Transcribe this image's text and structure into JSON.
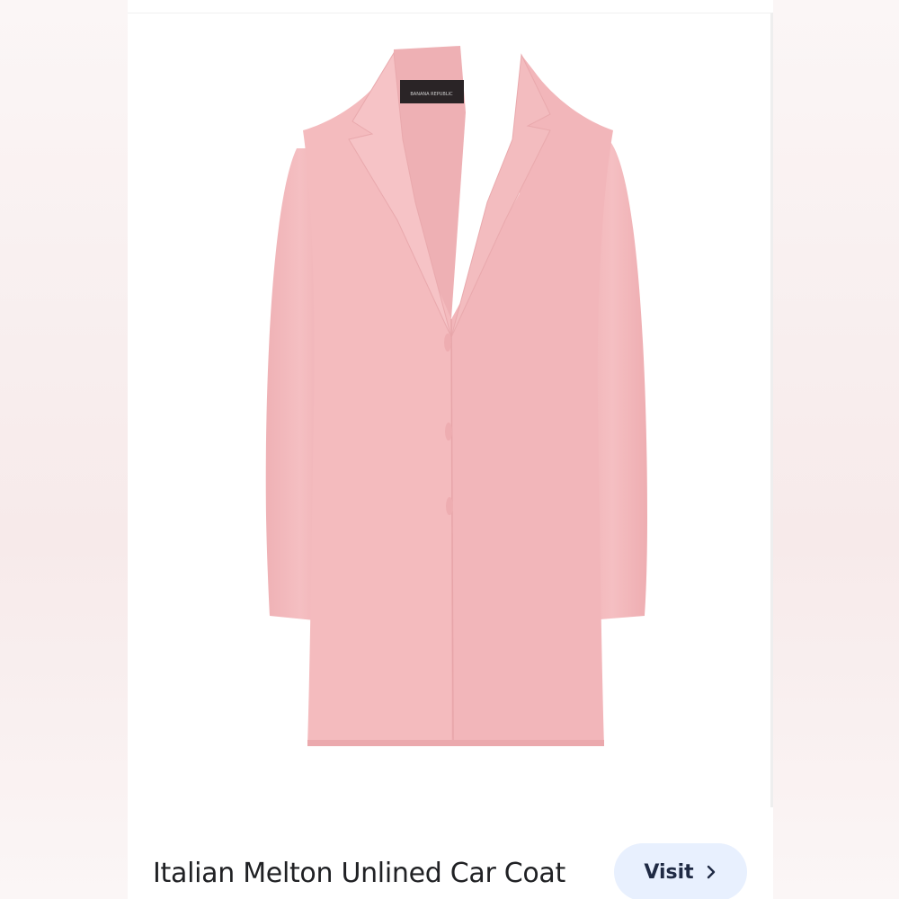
{
  "product": {
    "title": "Italian Melton Unlined Car Coat",
    "image_alt": "Pink single-breasted coat",
    "brand_label": "BANANA REPUBLIC",
    "coat_color": "#f3b8bb"
  },
  "actions": {
    "visit_label": "Visit",
    "visit_icon": "chevron-right-icon"
  }
}
